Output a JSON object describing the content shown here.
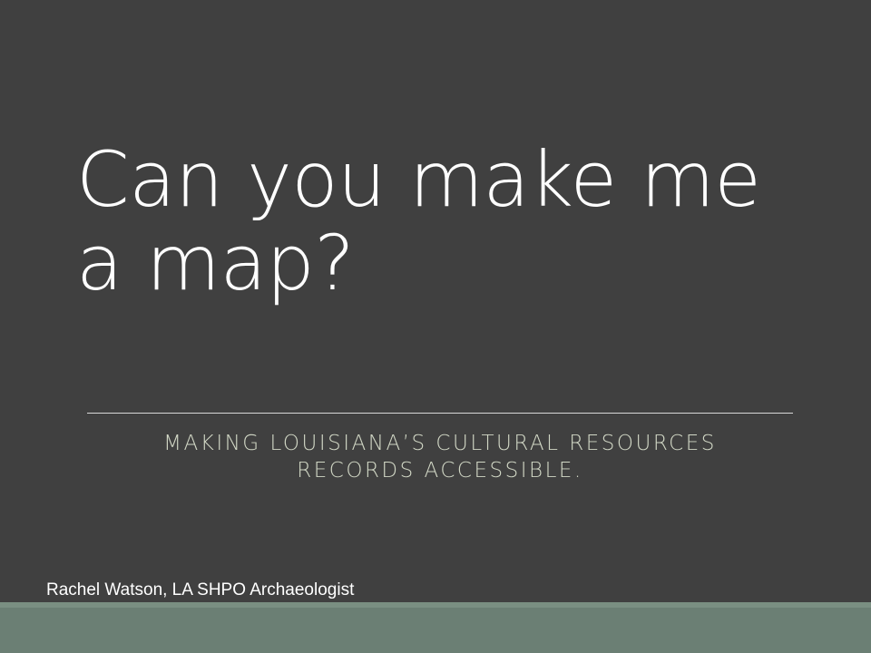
{
  "slide": {
    "title_line1": "Can you make me",
    "title_line2": "a map?",
    "subtitle_line1": "MAKING LOUISIANA’S CULTURAL RESOURCES",
    "subtitle_line2": "RECORDS ACCESSIBLE.",
    "author": "Rachel Watson, LA SHPO Archaeologist"
  },
  "colors": {
    "background": "#404040",
    "title": "#ffffff",
    "subtitle": "#d2d8c6",
    "footer_band": "#6b7f74"
  }
}
